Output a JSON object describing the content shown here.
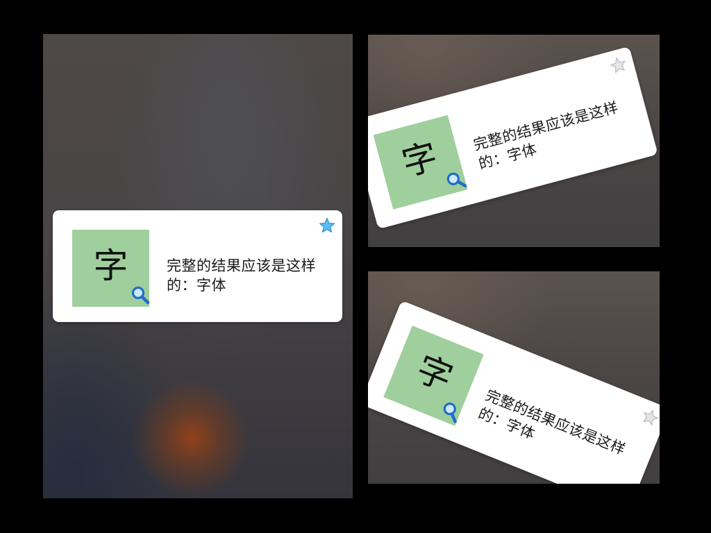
{
  "cards": {
    "main": {
      "glyph": "字",
      "definition": "完整的结果应该是这样的：字体",
      "favorited": true,
      "star_icon": "star-icon",
      "search_icon": "magnifier-icon"
    },
    "rotated_top": {
      "glyph": "字",
      "definition": "完整的结果应该是这样的：字体",
      "favorited": false,
      "star_icon": "star-icon",
      "search_icon": "magnifier-icon"
    },
    "rotated_bottom": {
      "glyph": "字",
      "definition": "完整的结果应该是这样的：字体",
      "favorited": false,
      "star_icon": "star-icon",
      "search_icon": "magnifier-icon"
    }
  },
  "colors": {
    "thumb_background": "#9fcf9c",
    "star_active": "#3fa9e6",
    "star_inactive": "#d8d8d8",
    "magnifier": "#1f6fc8"
  }
}
